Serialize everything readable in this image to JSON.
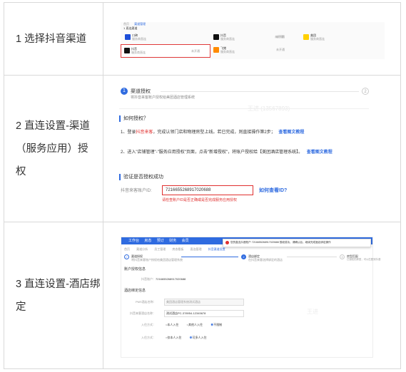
{
  "rows": [
    {
      "step_label": "1 选择抖音渠道"
    },
    {
      "step_label": "2 直连设置-渠道（服务应用）授权"
    },
    {
      "step_label": "3 直连设置-酒店绑定"
    }
  ],
  "shot1": {
    "tab_home": "首页",
    "tab_active": "渠道管理",
    "heading": "1 直连渠道",
    "channels": [
      {
        "name": "口碑",
        "sub": "服务商直连",
        "status": "未开通",
        "logo_color": "#1d4ed8",
        "logo_text": "口碑"
      },
      {
        "name": "抖音",
        "sub": "服务商直连",
        "status": "未开通",
        "logo_color": "#111111",
        "logo_text": "♪"
      },
      {
        "name": "美团",
        "sub": "服务商直连",
        "status": "未开通",
        "logo_color": "#ffd000",
        "logo_text": "美团"
      },
      {
        "name": "抖音",
        "sub": "服务商直连",
        "status": "未开通",
        "logo_color": "#111111",
        "logo_text": "♪"
      },
      {
        "name": "飞猪",
        "sub": "服务商直连",
        "status": "未开通",
        "logo_color": "#ff8a00",
        "logo_text": "飞猪"
      }
    ]
  },
  "shot2": {
    "step1_num": "1",
    "step1_title": "渠道授权",
    "step1_sub": "将抖音来客账户授权给美团酒店管理系统",
    "step2_num": "2",
    "watermark": "王进 (13567893)",
    "how_title": "如何授权？",
    "item1_prefix": "1、登录",
    "item1_link": "抖音来客",
    "item1_mid": "，完成认领门店和物理房型上线。若已完成，则直接操作第2步；",
    "item1_doc": "查看图文教程",
    "item2_text": "2、进入\"店铺管理\"-\"服务应用授权\"页面，点击\"新增授权\"，将账户授权给【美团酒店管理系统】。",
    "item2_doc": "查看图文教程",
    "verify_title": "验证是否授权成功",
    "id_label": "抖音来客账户ID:",
    "id_value": "7216655268917020688",
    "id_hint": "请检查账户ID是否正确或是否完成服务应用授权",
    "find_id_link": "如何查看ID?"
  },
  "shot3": {
    "nav": [
      "工作台",
      "房态",
      "预订",
      "财务",
      "会员"
    ],
    "alert": "您的直连抖音账户 7216655268917020688 授权成功，请确认后，继续完成酒店绑定操作",
    "tabs": [
      "首页",
      "渠道分析",
      "员工管理",
      "房态看板",
      "直连管理",
      "抖音渠道设置"
    ],
    "steps": [
      {
        "num": "✓",
        "title": "渠道授权",
        "sub": "将抖音来客账户授权给美团酒店管理系统"
      },
      {
        "num": "2",
        "title": "酒店绑定",
        "sub": "在抖音来客选择绑定的酒店"
      },
      {
        "num": "3",
        "title": "房型匹配",
        "sub": "已授权的房型，可以匹配到抖音"
      }
    ],
    "account_title": "账户授权信息",
    "account_label": "抖音账户：",
    "account_value": "7216655268917020688",
    "bind_title": "酒店绑定信息",
    "pms_label": "PMS酒店名称：",
    "pms_value": "美团酒店管理系统测试酒店",
    "douyin_label": "抖音来客酒店名称：",
    "douyin_value": "测试酒店PC-378954-12345678",
    "enter_label": "入住方式：",
    "enter_opts": [
      "本人入住",
      "其他人入住",
      "不限制"
    ],
    "leave_label": "入住方式：",
    "leave_opts": [
      "仅本人入住",
      "可多人入住"
    ],
    "watermark": "王进"
  }
}
